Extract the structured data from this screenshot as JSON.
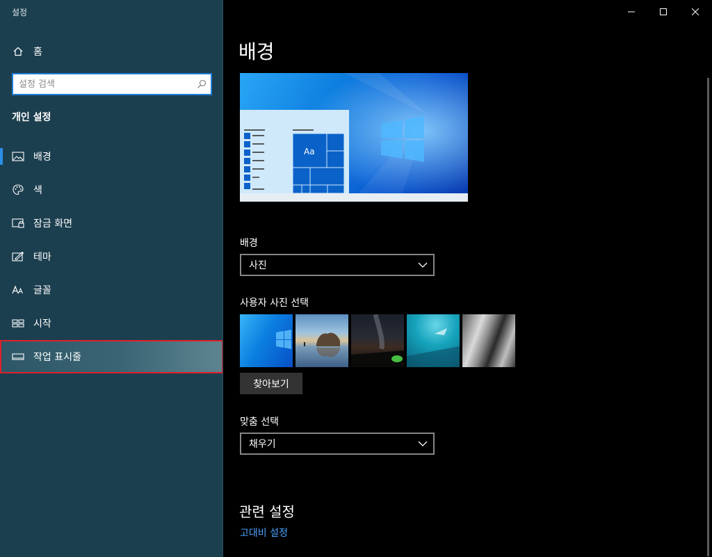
{
  "window": {
    "title": "설정",
    "controls": {
      "minimize": "minimize",
      "maximize": "maximize",
      "close": "close"
    }
  },
  "sidebar": {
    "home_label": "홈",
    "search_placeholder": "설정 검색",
    "section_title": "개인 설정",
    "items": [
      {
        "label": "배경",
        "icon": "picture-icon",
        "active": true
      },
      {
        "label": "색",
        "icon": "palette-icon"
      },
      {
        "label": "잠금 화면",
        "icon": "lock-screen-icon"
      },
      {
        "label": "테마",
        "icon": "theme-brush-icon"
      },
      {
        "label": "글꼴",
        "icon": "font-icon"
      },
      {
        "label": "시작",
        "icon": "start-icon"
      },
      {
        "label": "작업 표시줄",
        "icon": "taskbar-icon",
        "hovered": true
      }
    ]
  },
  "main": {
    "page_title": "배경",
    "preview": {
      "sample_text": "Aa"
    },
    "background_label": "배경",
    "background_value": "사진",
    "choose_photo_label": "사용자 사진 선택",
    "browse_label": "찾아보기",
    "fit_label": "맞춤 선택",
    "fit_value": "채우기",
    "related_title": "관련 설정",
    "links": [
      "고대비 설정"
    ]
  },
  "colors": {
    "sidebar_bg": "#1c3f4f",
    "accent": "#2c8fe8",
    "link": "#4aa3ff",
    "highlight_border": "#e0202a"
  }
}
